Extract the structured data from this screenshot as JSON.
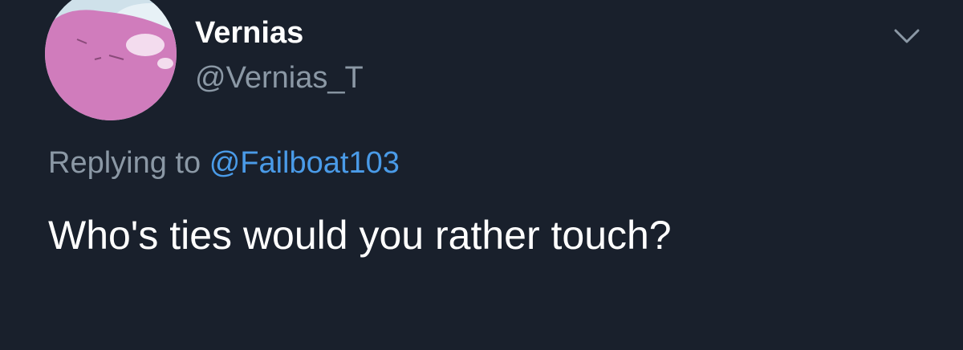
{
  "tweet": {
    "author": {
      "display_name": "Vernias",
      "handle": "@Vernias_T",
      "avatar_icon": "pink-blob-avatar"
    },
    "replying_to": {
      "prefix": "Replying to",
      "mention": "@Failboat103"
    },
    "text": "Who's ties would you rather touch?",
    "menu_icon": "chevron-down-icon"
  },
  "colors": {
    "background": "#19202c",
    "primary_text": "#ffffff",
    "secondary_text": "#8b98a5",
    "link": "#4a9be8",
    "avatar_pink": "#d37fc0"
  }
}
